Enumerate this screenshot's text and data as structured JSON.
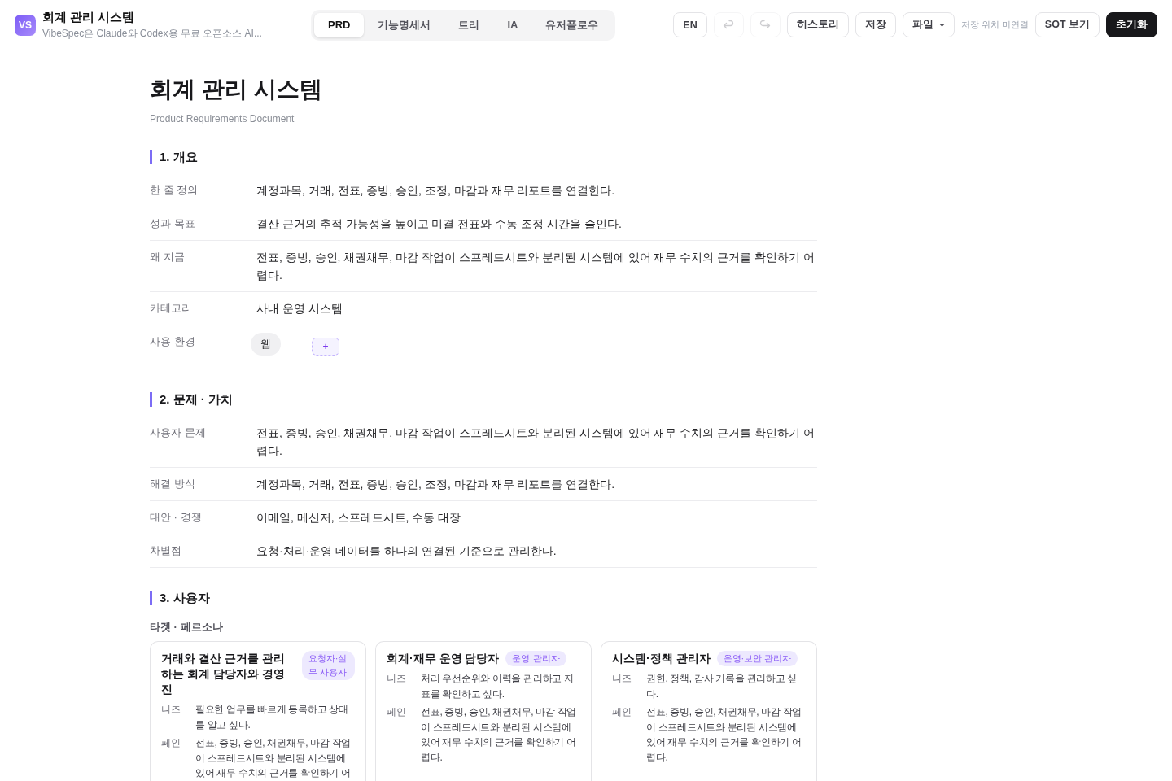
{
  "header": {
    "logo": "VS",
    "title": "회계 관리 시스템",
    "subtitle": "VibeSpec은 Claude와 Codex용 무료 오픈소스 AI...",
    "tabs": [
      {
        "label": "PRD",
        "selected": true
      },
      {
        "label": "기능명세서",
        "selected": false
      },
      {
        "label": "트리",
        "selected": false
      },
      {
        "label": "IA",
        "selected": false
      },
      {
        "label": "유저플로우",
        "selected": false
      }
    ],
    "toolbar": [
      {
        "kind": "button",
        "label": "EN",
        "disabled": false
      },
      {
        "kind": "undo",
        "disabled": true
      },
      {
        "kind": "redo",
        "disabled": true
      },
      {
        "kind": "button",
        "label": "히스토리",
        "disabled": false
      },
      {
        "kind": "button",
        "label": "저장",
        "disabled": false
      },
      {
        "kind": "menu",
        "label": "파일",
        "disabled": false
      },
      {
        "kind": "status",
        "label": "저장 위치 미연결"
      },
      {
        "kind": "button",
        "label": "SOT 보기",
        "disabled": false
      },
      {
        "kind": "primary",
        "label": "초기화",
        "disabled": false
      }
    ]
  },
  "document": {
    "title": "회계 관리 시스템",
    "subtitle": "Product Requirements Document",
    "sections": [
      {
        "heading": "1. 개요",
        "rows": [
          {
            "kind": "text",
            "label": "한 줄 정의",
            "value": "계정과목, 거래, 전표, 증빙, 승인, 조정, 마감과 재무 리포트를 연결한다."
          },
          {
            "kind": "text",
            "label": "성과 목표",
            "value": "결산 근거의 추적 가능성을 높이고 미결 전표와 수동 조정 시간을 줄인다."
          },
          {
            "kind": "text",
            "label": "왜 지금",
            "value": "전표, 증빙, 승인, 채권채무, 마감 작업이 스프레드시트와 분리된 시스템에 있어 재무 수치의 근거를 확인하기 어렵다."
          },
          {
            "kind": "text",
            "label": "카테고리",
            "value": "사내 운영 시스템"
          },
          {
            "kind": "chips",
            "label": "사용 환경",
            "chips": [
              "웹"
            ],
            "add_label": "+"
          }
        ]
      },
      {
        "heading": "2. 문제 · 가치",
        "rows": [
          {
            "kind": "text",
            "label": "사용자 문제",
            "value": "전표, 증빙, 승인, 채권채무, 마감 작업이 스프레드시트와 분리된 시스템에 있어 재무 수치의 근거를 확인하기 어렵다."
          },
          {
            "kind": "text",
            "label": "해결 방식",
            "value": "계정과목, 거래, 전표, 증빙, 승인, 조정, 마감과 재무 리포트를 연결한다."
          },
          {
            "kind": "text",
            "label": "대안 · 경쟁",
            "value": "이메일, 메신저, 스프레드시트, 수동 대장"
          },
          {
            "kind": "text",
            "label": "차별점",
            "value": "요청·처리·운영 데이터를 하나의 연결된 기준으로 관리한다."
          }
        ]
      },
      {
        "heading": "3. 사용자",
        "subheading": "타겟 · 페르소나",
        "personas": [
          {
            "name": "거래와 결산 근거를 관리하는 회계 담당자와 경영진",
            "role": "요청자·실무 사용자",
            "details": [
              {
                "label": "니즈",
                "text": "필요한 업무를 빠르게 등록하고 상태를 알고 싶다."
              },
              {
                "label": "페인",
                "text": "전표, 증빙, 승인, 채권채무, 마감 작업이 스프레드시트와 분리된 시스템에 있어 재무 수치의 근거를 확인하기 어"
              }
            ]
          },
          {
            "name": "회계·재무 운영 담당자",
            "role": "운영 관리자",
            "details": [
              {
                "label": "니즈",
                "text": "처리 우선순위와 이력을 관리하고 지표를 확인하고 싶다."
              },
              {
                "label": "페인",
                "text": "전표, 증빙, 승인, 채권채무, 마감 작업이 스프레드시트와 분리된 시스템에 있어 재무 수치의 근거를 확인하기 어렵다."
              }
            ]
          },
          {
            "name": "시스템·정책 관리자",
            "role": "운영·보안 관리자",
            "details": [
              {
                "label": "니즈",
                "text": "권한, 정책, 감사 기록을 관리하고 싶다."
              },
              {
                "label": "페인",
                "text": "전표, 증빙, 승인, 채권채무, 마감 작업이 스프레드시트와 분리된 시스템에 있어 재무 수치의 근거를 확인하기 어렵다."
              }
            ]
          }
        ]
      }
    ]
  }
}
